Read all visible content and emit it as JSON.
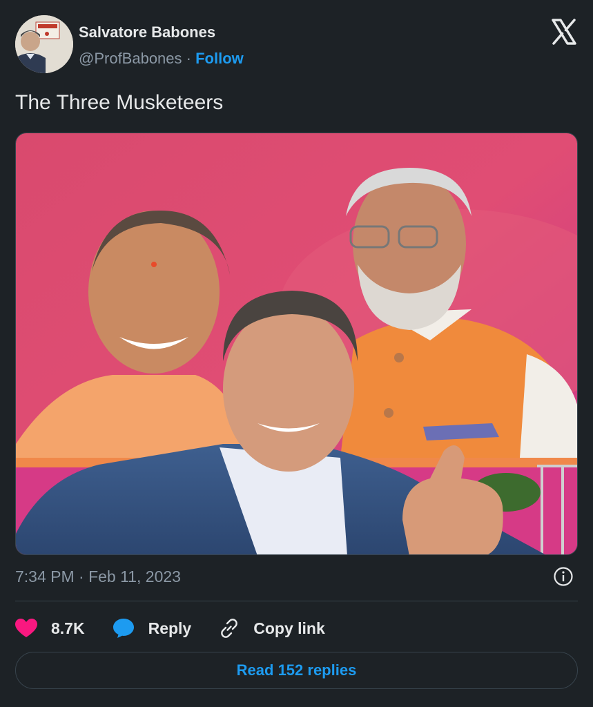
{
  "author": {
    "name": "Salvatore Babones",
    "handle": "@ProfBabones",
    "separator": "·",
    "follow_label": "Follow"
  },
  "tweet": {
    "text": "The Three Musketeers",
    "timestamp": "7:34 PM · Feb 11, 2023"
  },
  "actions": {
    "likes": "8.7K",
    "reply_label": "Reply",
    "copy_label": "Copy link"
  },
  "read_replies_label": "Read 152 replies",
  "colors": {
    "background": "#1d2226",
    "accent": "#1d9bf0",
    "like": "#f91880",
    "text": "#e7e9ea",
    "muted": "#8b98a5"
  },
  "icons": [
    "x-logo-icon",
    "info-icon",
    "heart-icon",
    "reply-bubble-icon",
    "link-icon"
  ]
}
